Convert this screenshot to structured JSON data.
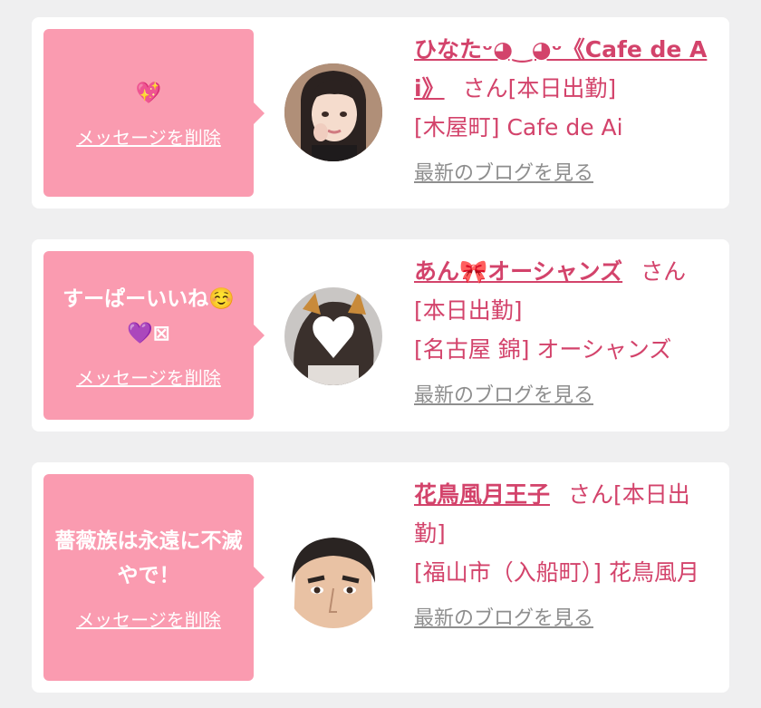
{
  "entries": [
    {
      "message": "💖",
      "delete_label": "メッセージを削除",
      "name": "ひなたᵕ◕‿◕ᵕ《Cafe de Ai》",
      "suffix": "さん[本日出勤]",
      "shop": "[木屋町] Cafe de Ai",
      "blog_label": "最新のブログを見る"
    },
    {
      "message": "すーぱーいいね☺️ 💜⊠",
      "delete_label": "メッセージを削除",
      "name": "あん🎀オーシャンズ",
      "suffix": "さん[本日出勤]",
      "shop": "[名古屋 錦] オーシャンズ",
      "blog_label": "最新のブログを見る"
    },
    {
      "message": "薔薇族は永遠に不滅やで！",
      "delete_label": "メッセージを削除",
      "name": "花鳥風月王子",
      "suffix": "さん[本日出勤]",
      "shop": "[福山市（入船町）] 花鳥風月",
      "blog_label": "最新のブログを見る"
    }
  ],
  "colors": {
    "accent": "#d3436b",
    "bubble": "#fa9bb0",
    "muted_link": "#8e8e8e",
    "background": "#efeff0"
  }
}
